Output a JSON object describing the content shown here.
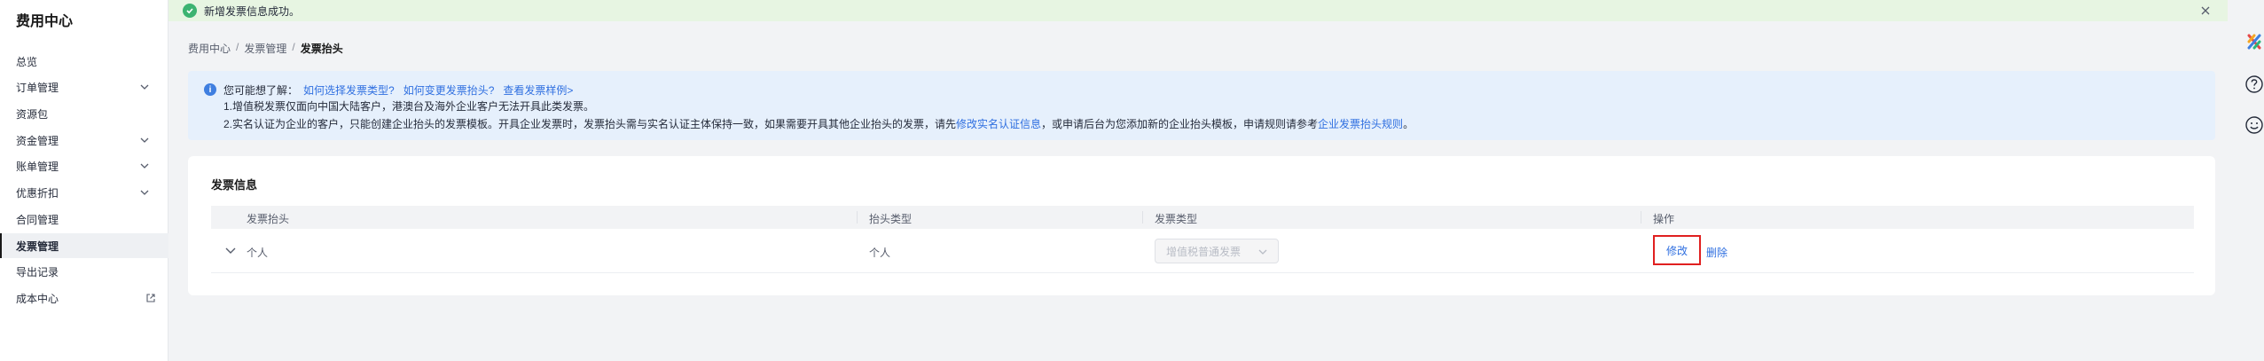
{
  "sidebar": {
    "title": "费用中心",
    "items": [
      {
        "label": "总览"
      },
      {
        "label": "订单管理"
      },
      {
        "label": "资源包"
      },
      {
        "label": "资金管理"
      },
      {
        "label": "账单管理"
      },
      {
        "label": "优惠折扣"
      },
      {
        "label": "合同管理"
      },
      {
        "label": "发票管理"
      },
      {
        "label": "导出记录"
      },
      {
        "label": "成本中心"
      }
    ]
  },
  "banner": {
    "message": "新增发票信息成功。",
    "status_color": "#3cb371"
  },
  "breadcrumb": {
    "items": [
      "费用中心",
      "发票管理",
      "发票抬头"
    ],
    "separator": "/"
  },
  "info": {
    "prompt": "您可能想了解：",
    "links": [
      "如何选择发票类型?",
      "如何变更发票抬头?",
      "查看发票样例>"
    ],
    "line1": "1.增值税发票仅面向中国大陆客户，港澳台及海外企业客户无法开具此类发票。",
    "line2_a": "2.实名认证为企业的客户，只能创建企业抬头的发票模板。开具企业发票时，发票抬头需与实名认证主体保持一致，如果需要开具其他企业抬头的发票，请先",
    "line2_link1": "修改实名认证信息",
    "line2_b": "，或申请后台为您添加新的企业抬头模板，申请规则请参考",
    "line2_link2": "企业发票抬头规则",
    "line2_c": "。"
  },
  "card": {
    "title": "发票信息",
    "columns": [
      "发票抬头",
      "抬头类型",
      "发票类型",
      "操作"
    ],
    "rows": [
      {
        "title": "个人",
        "title_type": "个人",
        "invoice_type": "增值税普通发票",
        "edit_label": "修改",
        "delete_label": "删除"
      }
    ]
  },
  "colors": {
    "accent": "#2f6fe0",
    "highlight_border": "#e02020"
  }
}
